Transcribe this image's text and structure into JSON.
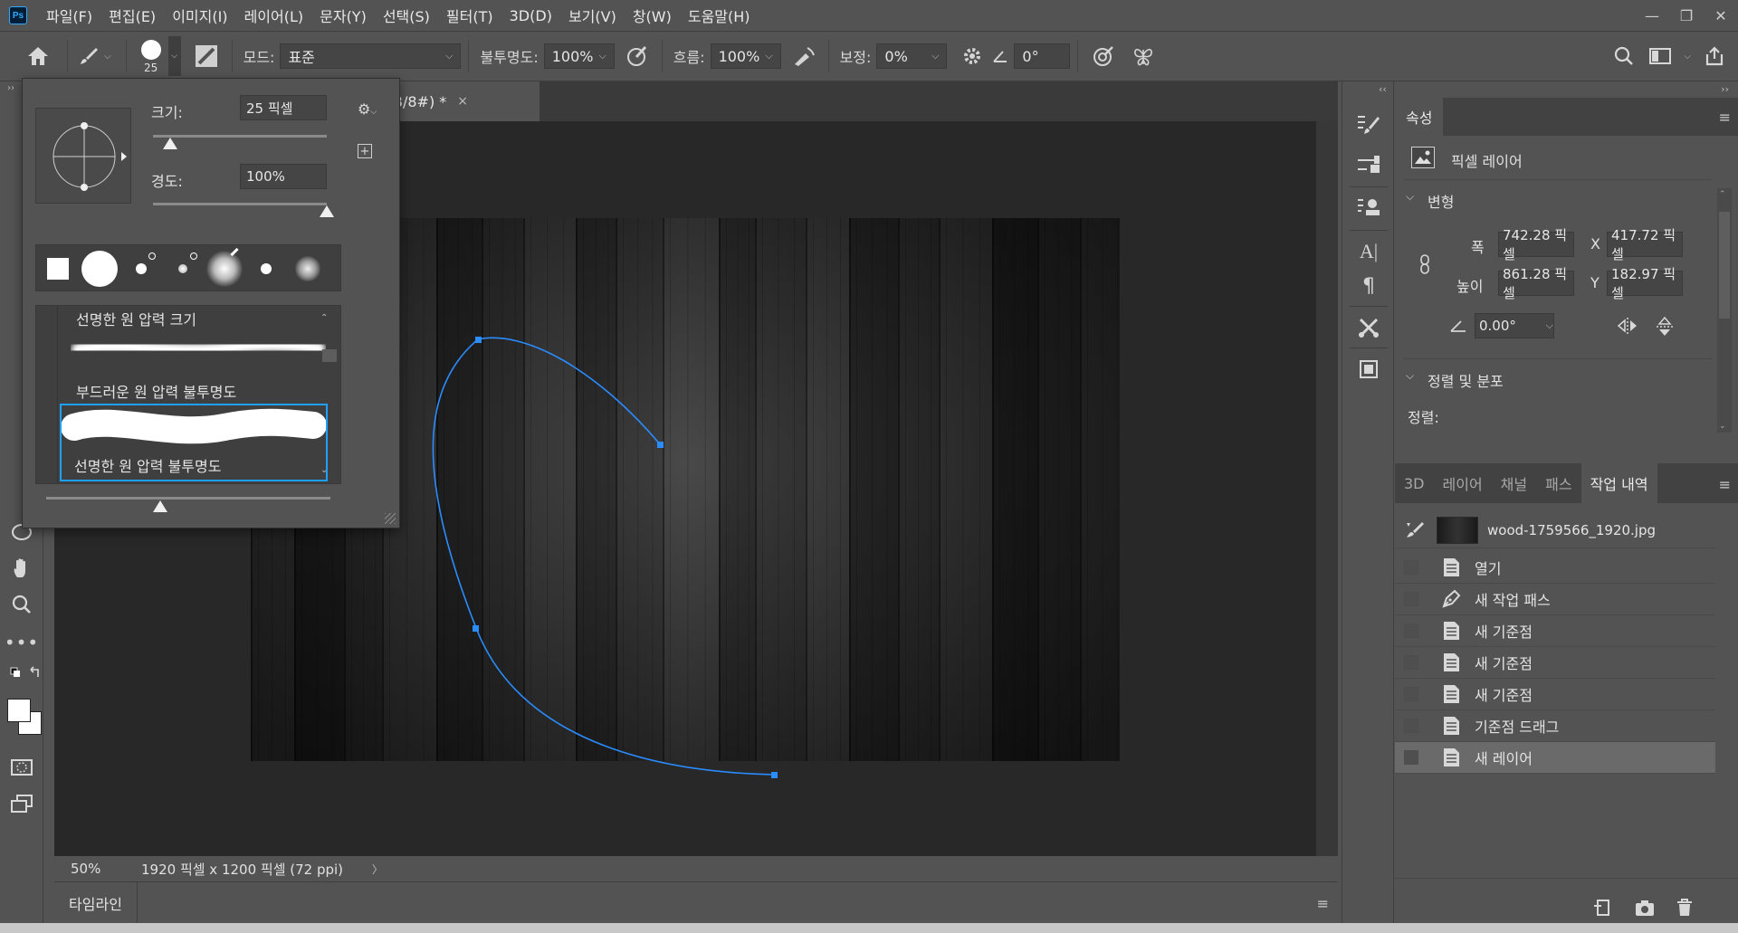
{
  "app": {
    "logo": "Ps"
  },
  "menu": [
    "파일(F)",
    "편집(E)",
    "이미지(I)",
    "레이어(L)",
    "문자(Y)",
    "선택(S)",
    "필터(T)",
    "3D(D)",
    "보기(V)",
    "창(W)",
    "도움말(H)"
  ],
  "window_controls": {
    "minimize": "—",
    "restore": "❐",
    "close": "✕"
  },
  "options": {
    "brush_size": "25",
    "mode_label": "모드:",
    "mode_value": "표준",
    "opacity_label": "불투명도:",
    "opacity_value": "100%",
    "flow_label": "흐름:",
    "flow_value": "100%",
    "smoothing_label": "보정:",
    "smoothing_value": "0%",
    "angle_value": "0°"
  },
  "document": {
    "tab_title": "B/8#) *",
    "tab_close": "×",
    "zoom": "50%",
    "doc_info": "1920 픽셀 x 1200 픽셀 (72 ppi)",
    "status_arrow": "〉"
  },
  "timeline": {
    "label": "타임라인"
  },
  "brush_panel": {
    "size_label": "크기:",
    "size_value": "25 픽셀",
    "size_fraction": 0.1,
    "hardness_label": "경도:",
    "hardness_value": "100%",
    "hardness_fraction": 1.0,
    "brushes": [
      {
        "name": "선명한 원 압력 크기"
      },
      {
        "name": "부드러운 원 압력 불투명도"
      },
      {
        "name": "선명한 원 압력 불투명도"
      }
    ],
    "preview_size_fraction": 0.4
  },
  "properties": {
    "tab": "속성",
    "layer_type": "픽셀 레이어",
    "transform_header": "변형",
    "width_label": "폭",
    "width_value": "742.28 픽셀",
    "height_label": "높이",
    "height_value": "861.28 픽셀",
    "x_label": "X",
    "x_value": "417.72 픽셀",
    "y_label": "Y",
    "y_value": "182.97 픽셀",
    "angle_value": "0.00°",
    "align_header": "정렬 및 분포",
    "align_label": "정렬:"
  },
  "bottom_tabs": [
    "3D",
    "레이어",
    "채널",
    "패스",
    "작업 내역"
  ],
  "history": {
    "snapshot_name": "wood-1759566_1920.jpg",
    "items": [
      {
        "label": "열기",
        "icon": "document-icon"
      },
      {
        "label": "새 작업 패스",
        "icon": "pen-icon"
      },
      {
        "label": "새 기준점",
        "icon": "document-icon"
      },
      {
        "label": "새 기준점",
        "icon": "document-icon"
      },
      {
        "label": "새 기준점",
        "icon": "document-icon"
      },
      {
        "label": "기준점 드래그",
        "icon": "document-icon"
      },
      {
        "label": "새 레이어",
        "icon": "document-icon"
      }
    ],
    "active_index": 6
  },
  "colors": {
    "accent": "#31a8ff",
    "path": "#2a8cff",
    "selection_border": "#1ea0ff"
  }
}
